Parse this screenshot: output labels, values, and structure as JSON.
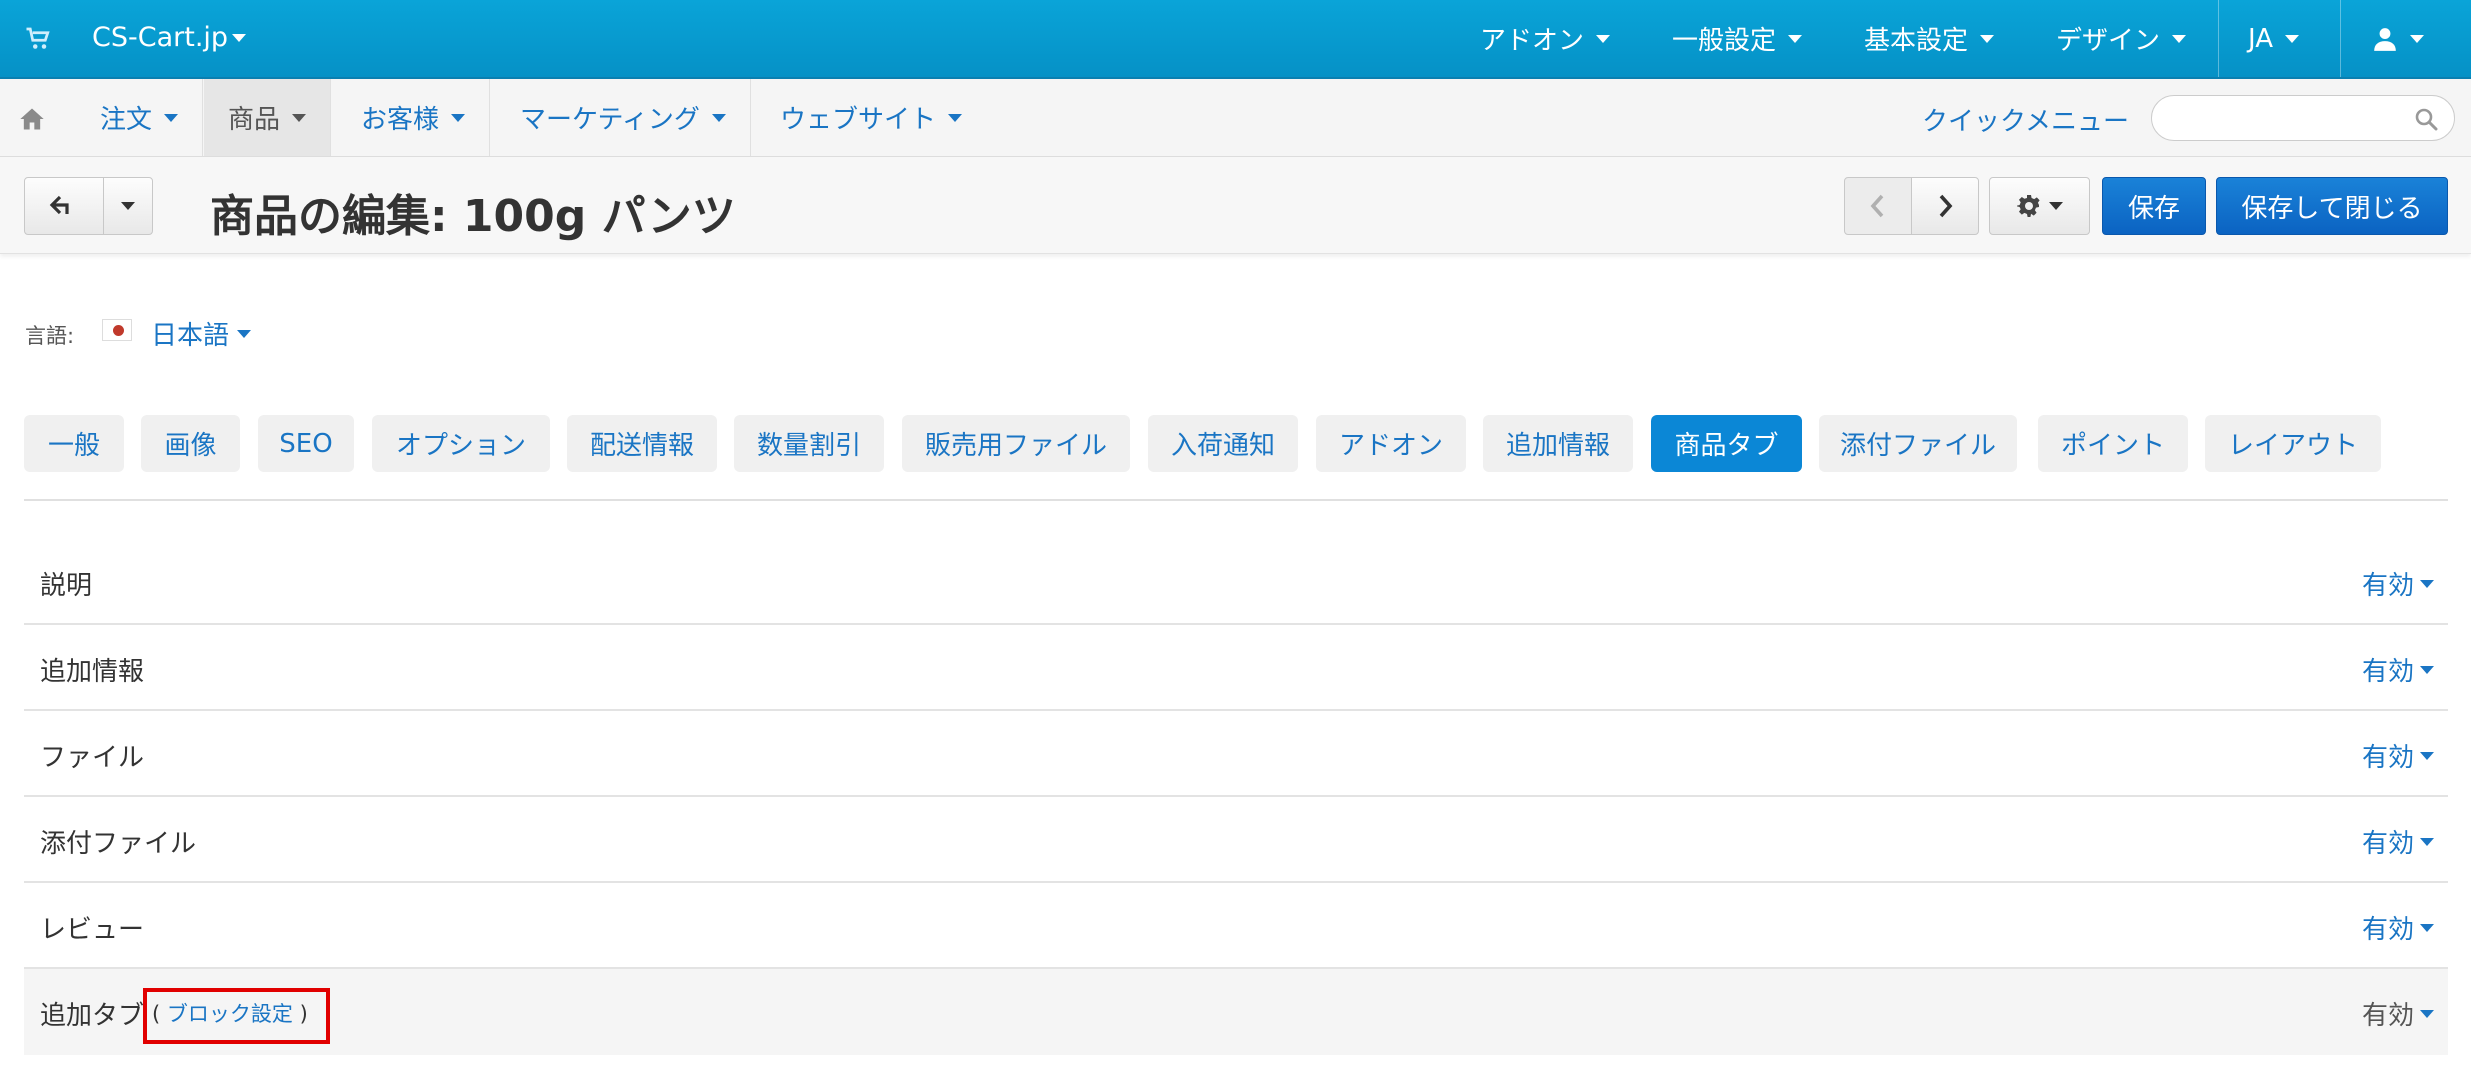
{
  "topbar": {
    "brand": "CS-Cart.jp",
    "menus": [
      "アドオン",
      "一般設定",
      "基本設定",
      "デザイン",
      "JA"
    ],
    "icons": [
      "cart-icon",
      "user-icon"
    ]
  },
  "subnav": {
    "items": [
      "注文",
      "商品",
      "お客様",
      "マーケティング",
      "ウェブサイト"
    ],
    "active_item": "商品",
    "quick_menu": "クイックメニュー",
    "search_placeholder": ""
  },
  "toolbar": {
    "title": "商品の編集: 100g パンツ",
    "save": "保存",
    "save_close": "保存して閉じる"
  },
  "language": {
    "label": "言語:",
    "value": "日本語"
  },
  "tabs": [
    "一般",
    "画像",
    "SEO",
    "オプション",
    "配送情報",
    "数量割引",
    "販売用ファイル",
    "入荷通知",
    "アドオン",
    "追加情報",
    "商品タブ",
    "添付ファイル",
    "ポイント",
    "レイアウト"
  ],
  "active_tab": "商品タブ",
  "rows": [
    {
      "label": "説明",
      "status": "有効"
    },
    {
      "label": "追加情報",
      "status": "有効"
    },
    {
      "label": "ファイル",
      "status": "有効"
    },
    {
      "label": "添付ファイル",
      "status": "有効"
    },
    {
      "label": "レビュー",
      "status": "有効"
    },
    {
      "label": "追加タブ",
      "status": "有効"
    }
  ],
  "block_link": {
    "open": "(",
    "text": "ブロック設定",
    "close": ")"
  },
  "colors": {
    "topbar": "#0aa4d8",
    "link": "#1a75c4",
    "primary_button": "#0b63c2",
    "active_tab": "#0b87d6",
    "highlight_box": "#e10000"
  }
}
